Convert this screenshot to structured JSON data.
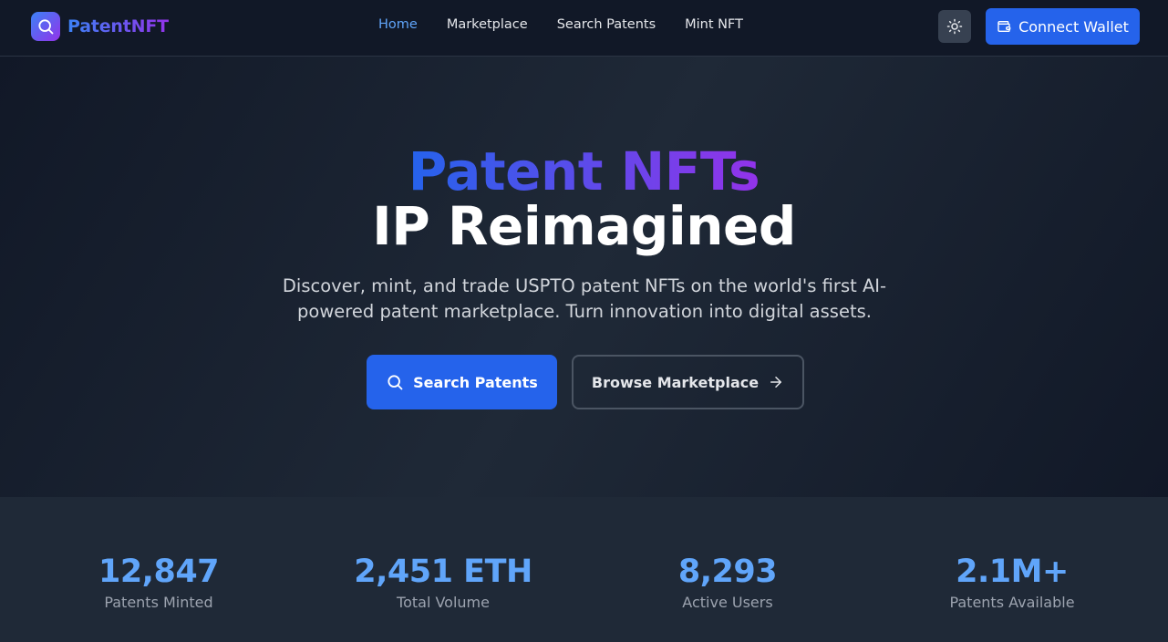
{
  "navbar": {
    "brand": "PatentNFT",
    "links": [
      "Home",
      "Marketplace",
      "Search Patents",
      "Mint NFT"
    ],
    "active_link": "Home",
    "theme_toggle_icon": "sun-icon",
    "wallet_button": "Connect Wallet"
  },
  "hero": {
    "title_gradient": "Patent NFTs",
    "title_plain": "IP Reimagined",
    "subtitle": "Discover, mint, and trade USPTO patent NFTs on the world's first AI-powered patent marketplace. Turn innovation into digital assets.",
    "primary_button": "Search Patents",
    "secondary_button": "Browse Marketplace"
  },
  "stats": [
    {
      "value": "12,847",
      "label": "Patents Minted"
    },
    {
      "value": "2,451 ETH",
      "label": "Total Volume"
    },
    {
      "value": "8,293",
      "label": "Active Users"
    },
    {
      "value": "2.1M+",
      "label": "Patents Available"
    }
  ],
  "colors": {
    "accent": "#2563eb",
    "accent_light": "#60a5fa",
    "gradient_end": "#9333ea",
    "background": "#111827",
    "surface": "#1f2937"
  }
}
